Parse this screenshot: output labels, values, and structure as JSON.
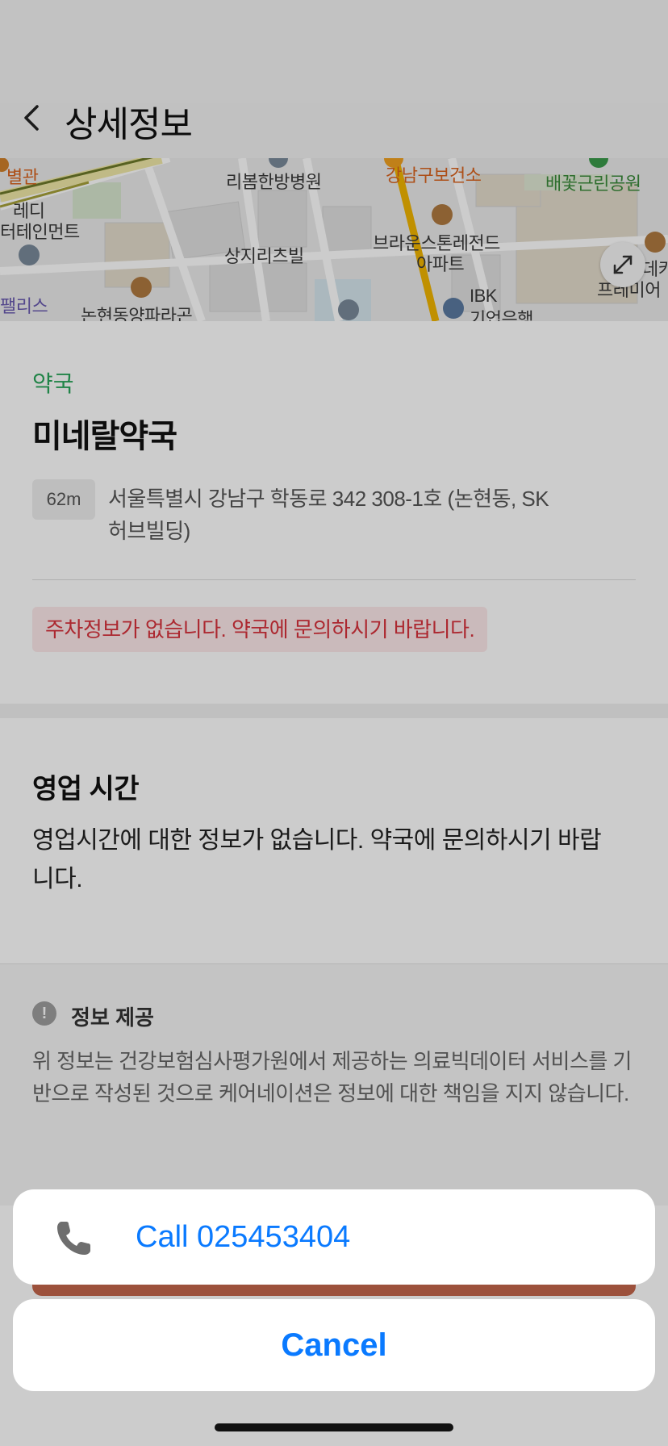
{
  "header": {
    "back_icon": "chevron-left-icon",
    "title": "상세정보"
  },
  "map": {
    "labels": [
      "별관",
      "레디",
      "터테인먼트",
      "리봄한방병원",
      "강남구보건소",
      "배꽃근린공원",
      "상지리츠빌",
      "브라운스톤레전드",
      "아파트",
      "팰리스",
      "논현동양파라곤",
      "IBK",
      "기업은행",
      "데카",
      "프레미어"
    ],
    "expand_icon": "expand-icon"
  },
  "place": {
    "category": "약국",
    "name": "미네랄약국",
    "distance": "62m",
    "address": "서울특별시 강남구 학동로 342 308-1호 (논현동, SK허브빌딩)",
    "parking_note": "주차정보가 없습니다. 약국에 문의하시기 바랍니다."
  },
  "hours": {
    "title": "영업 시간",
    "text": "영업시간에 대한 정보가 없습니다. 약국에 문의하시기 바랍니다."
  },
  "provider": {
    "icon": "info-icon",
    "icon_glyph": "!",
    "title": "정보 제공",
    "text": "위 정보는 건강보험심사평가원에서 제공하는 의료빅데이터 서비스를 기반으로 작성된 것으로 케어네이션은 정보에 대한 책임을 지지 않습니다."
  },
  "action_sheet": {
    "call_icon": "phone-icon",
    "call_label": "Call 025453404",
    "cancel_label": "Cancel"
  },
  "colors": {
    "accent_blue": "#0a7aff",
    "category_green": "#2aa55a",
    "warning_red": "#d8323c",
    "warning_bg": "#fde9ea",
    "bottom_button": "#c3664c"
  }
}
